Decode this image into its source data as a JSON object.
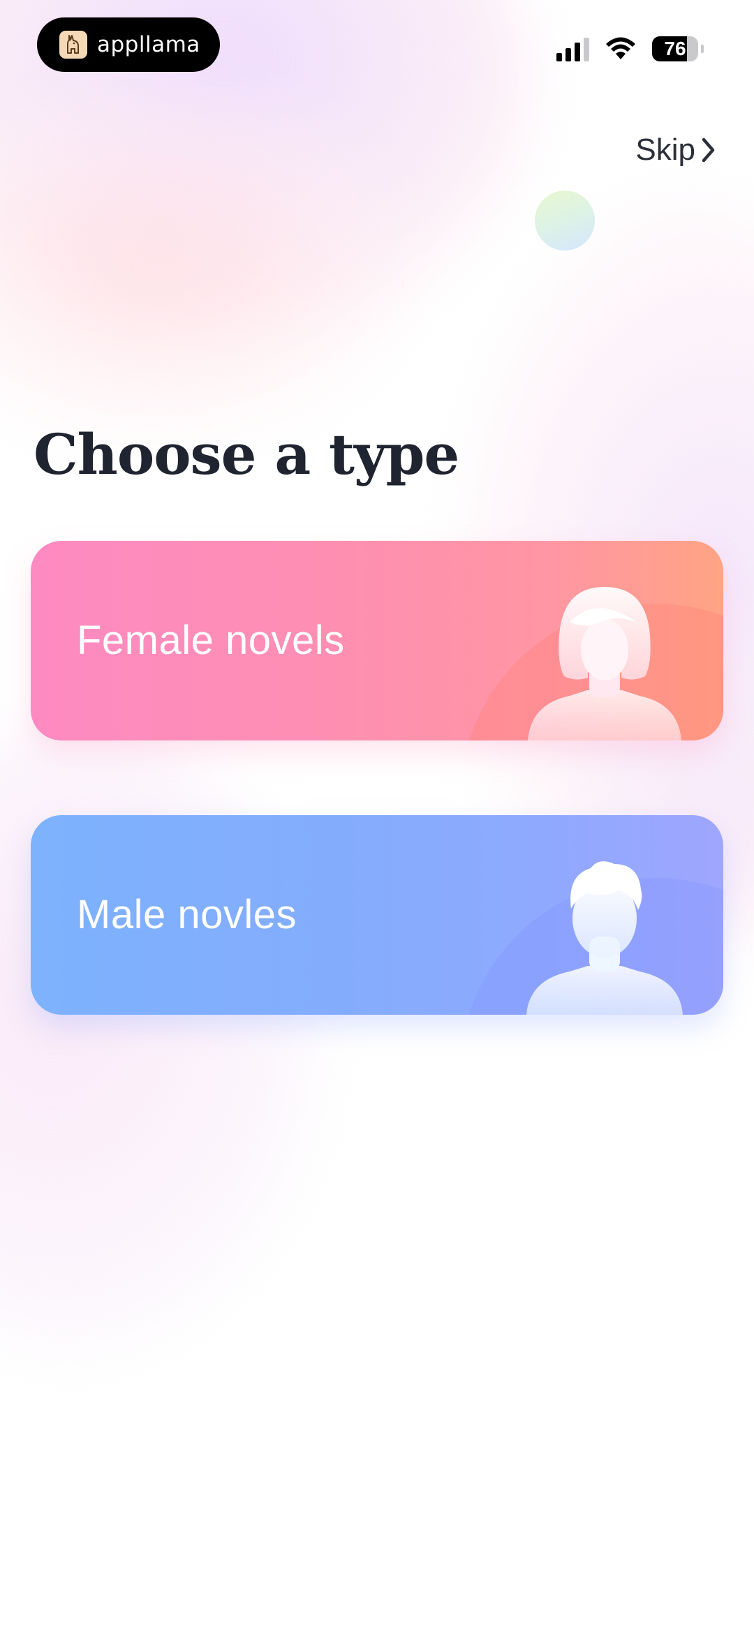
{
  "status_bar": {
    "app_name": "appllama",
    "battery": "76",
    "battery_level": 0.76
  },
  "header": {
    "skip_label": "Skip"
  },
  "main": {
    "title": "Choose a type",
    "types": [
      {
        "label": "Female novels",
        "icon": "female-avatar-icon",
        "colors": [
          "#fe8ac2",
          "#ffa484"
        ]
      },
      {
        "label": "Male novles",
        "icon": "male-avatar-icon",
        "colors": [
          "#7db2fd",
          "#9fa6fd"
        ]
      }
    ]
  }
}
